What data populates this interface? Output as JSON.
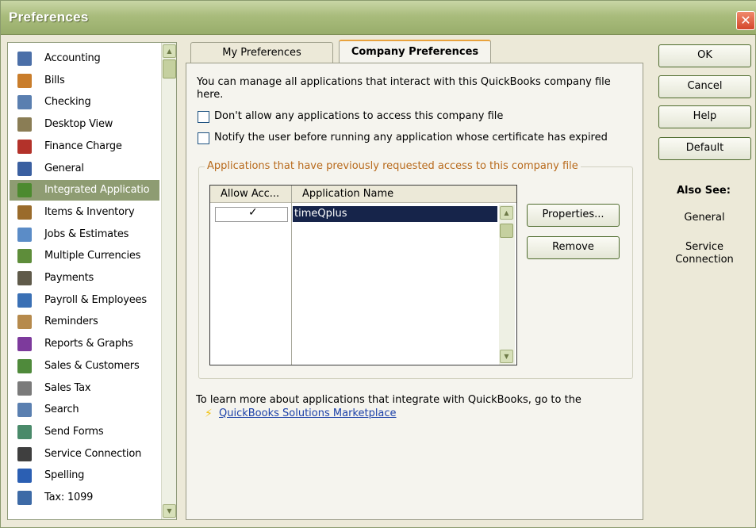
{
  "window": {
    "title": "Preferences",
    "close_symbol": "✕"
  },
  "sidebar": {
    "items": [
      {
        "label": "Accounting",
        "icon": "accounting-icon",
        "color": "#4b6fa8"
      },
      {
        "label": "Bills",
        "icon": "bills-icon",
        "color": "#c97d2b"
      },
      {
        "label": "Checking",
        "icon": "checking-icon",
        "color": "#5a7fb0"
      },
      {
        "label": "Desktop View",
        "icon": "desktop-view-icon",
        "color": "#8a7d55"
      },
      {
        "label": "Finance Charge",
        "icon": "finance-charge-icon",
        "color": "#b3322a"
      },
      {
        "label": "General",
        "icon": "general-icon",
        "color": "#3a5fa0"
      },
      {
        "label": "Integrated Applicatio",
        "icon": "integrated-applications-icon",
        "color": "#4c8a2f"
      },
      {
        "label": "Items & Inventory",
        "icon": "items-inventory-icon",
        "color": "#9a6b2b"
      },
      {
        "label": "Jobs & Estimates",
        "icon": "jobs-estimates-icon",
        "color": "#5b8cc7"
      },
      {
        "label": "Multiple Currencies",
        "icon": "multiple-currencies-icon",
        "color": "#5e8d3a"
      },
      {
        "label": "Payments",
        "icon": "payments-icon",
        "color": "#5f5a4a"
      },
      {
        "label": "Payroll & Employees",
        "icon": "payroll-employees-icon",
        "color": "#3a70b5"
      },
      {
        "label": "Reminders",
        "icon": "reminders-icon",
        "color": "#b68a4c"
      },
      {
        "label": "Reports & Graphs",
        "icon": "reports-graphs-icon",
        "color": "#7d3a9c"
      },
      {
        "label": "Sales & Customers",
        "icon": "sales-customers-icon",
        "color": "#4f8a3b"
      },
      {
        "label": "Sales Tax",
        "icon": "sales-tax-icon",
        "color": "#7a7a7a"
      },
      {
        "label": "Search",
        "icon": "search-icon",
        "color": "#5a7fb0"
      },
      {
        "label": "Send Forms",
        "icon": "send-forms-icon",
        "color": "#4a8a6a"
      },
      {
        "label": "Service Connection",
        "icon": "service-connection-icon",
        "color": "#3f3f3f"
      },
      {
        "label": "Spelling",
        "icon": "spelling-icon",
        "color": "#2b5fb3"
      },
      {
        "label": "Tax: 1099",
        "icon": "tax-1099-icon",
        "color": "#3d6aa6"
      }
    ],
    "selected_index": 6
  },
  "tabs": {
    "my_preferences": "My Preferences",
    "company_preferences": "Company Preferences"
  },
  "content": {
    "intro": "You can manage all applications that interact with this QuickBooks company file here.",
    "checkbox_no_access": "Don't allow any applications to access this company file",
    "checkbox_notify": "Notify the user before running any application whose certificate has expired",
    "group_label": "Applications that have previously requested access to this company file",
    "columns": {
      "allow": "Allow Acc...",
      "name": "Application Name"
    },
    "rows": [
      {
        "allow": "✓",
        "name": "timeQplus"
      }
    ],
    "footnote": "To learn more about applications that integrate with QuickBooks, go to the",
    "marketplace_link": "QuickBooks Solutions Marketplace"
  },
  "buttons": {
    "properties": "Properties...",
    "remove": "Remove",
    "ok": "OK",
    "cancel": "Cancel",
    "help": "Help",
    "default": "Default"
  },
  "also_see": {
    "title": "Also See:",
    "links": [
      "General",
      "Service Connection"
    ]
  }
}
